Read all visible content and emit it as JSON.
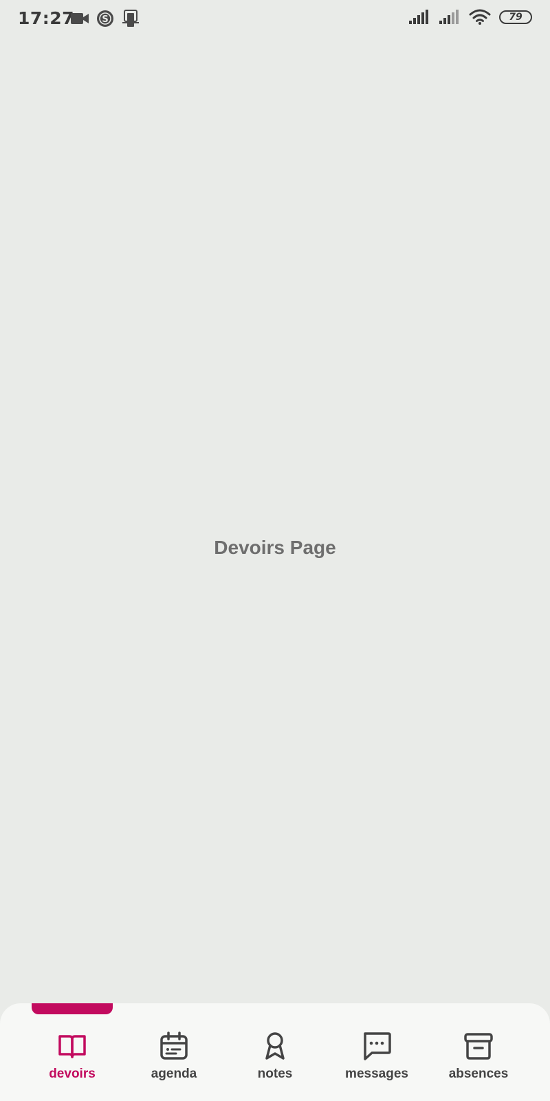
{
  "status_bar": {
    "time": "17:27",
    "battery": "79",
    "left_icons": [
      "video-camera-icon",
      "s-circle-icon",
      "device-icon"
    ],
    "right_icons": [
      "signal-icon",
      "signal-weak-icon",
      "wifi-icon",
      "battery-icon"
    ]
  },
  "page": {
    "title": "Devoirs Page"
  },
  "bottom_nav": {
    "accent_color": "#c20a5e",
    "default_color": "#444444",
    "active_index": 0,
    "items": [
      {
        "label": "devoirs",
        "icon": "book-open-icon"
      },
      {
        "label": "agenda",
        "icon": "calendar-icon"
      },
      {
        "label": "notes",
        "icon": "award-icon"
      },
      {
        "label": "messages",
        "icon": "message-icon"
      },
      {
        "label": "absences",
        "icon": "archive-icon"
      }
    ]
  }
}
